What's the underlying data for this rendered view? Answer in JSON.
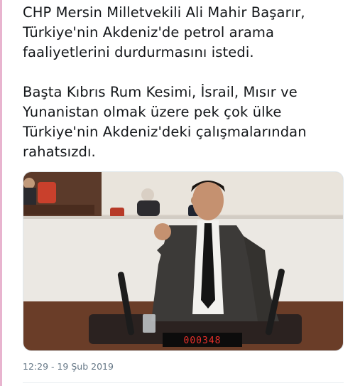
{
  "tweet": {
    "paragraphs": [
      {
        "lines": [
          "CHP Mersin Milletvekili Ali Mahir Başarır,",
          "Türkiye'nin Akdeniz'de petrol arama",
          "faaliyetlerini durdurmasını istedi."
        ]
      },
      {
        "lines": [
          "Başta Kıbrıs Rum Kesimi, İsrail, Mısır ve",
          "Yunanistan olmak üzere pek çok ülke",
          "Türkiye'nin Akdeniz'deki çalışmalarından",
          "rahatsızdı."
        ]
      }
    ],
    "media": {
      "timer_display": "000348"
    },
    "timestamp": "12:29 - 19 Şub 2019"
  },
  "colors": {
    "text": "#14171a",
    "muted": "#657786",
    "accent_rule": "#e8b4cf"
  }
}
